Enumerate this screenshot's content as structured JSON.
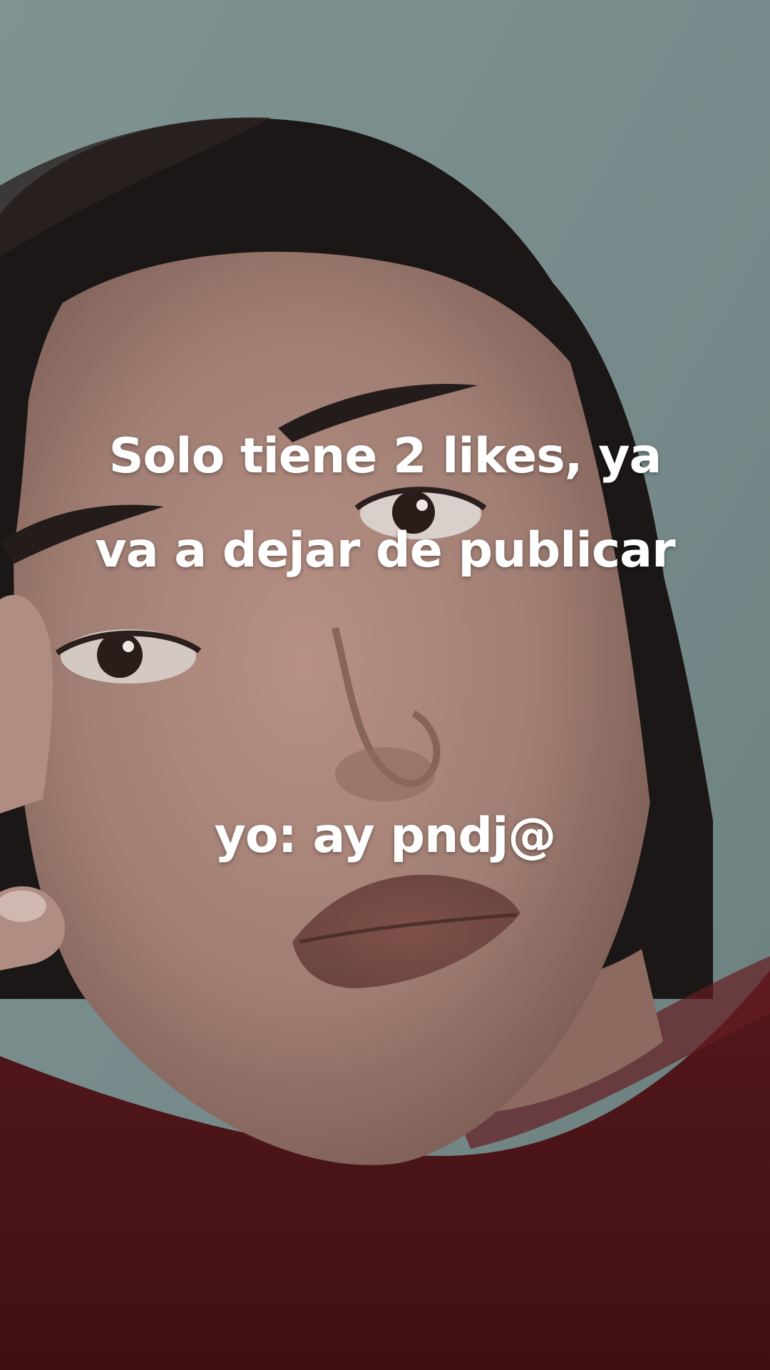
{
  "overlay_text": {
    "line_1": "Solo tiene 2 likes, ya",
    "line_2": "va a dejar de publicar",
    "line_3": "yo: ay pndj@"
  },
  "colors": {
    "background_wall": "#7c918e",
    "shirt": "#4a1418",
    "skin": "#a9847a",
    "hair": "#1a1515",
    "text": "#ffffff"
  }
}
